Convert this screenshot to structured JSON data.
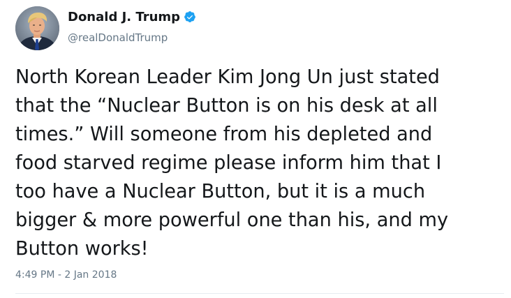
{
  "author": {
    "display_name": "Donald J. Trump",
    "handle": "@realDonaldTrump",
    "verified": true,
    "avatar_icon": "profile-photo"
  },
  "tweet": {
    "text_lines": [
      "North Korean Leader Kim Jong Un just stated",
      "that the “Nuclear Button is on his desk at all",
      "times.” Will someone from his depleted and",
      "food starved regime please inform him that I",
      "too have a Nuclear Button, but it is a much",
      "bigger & more powerful one than his, and my",
      "Button works!"
    ],
    "timestamp": "4:49 PM - 2 Jan 2018"
  },
  "colors": {
    "text": "#14171a",
    "secondary_text": "#657786",
    "verified_badge": "#1da1f2",
    "divider": "#e6ecf0"
  }
}
